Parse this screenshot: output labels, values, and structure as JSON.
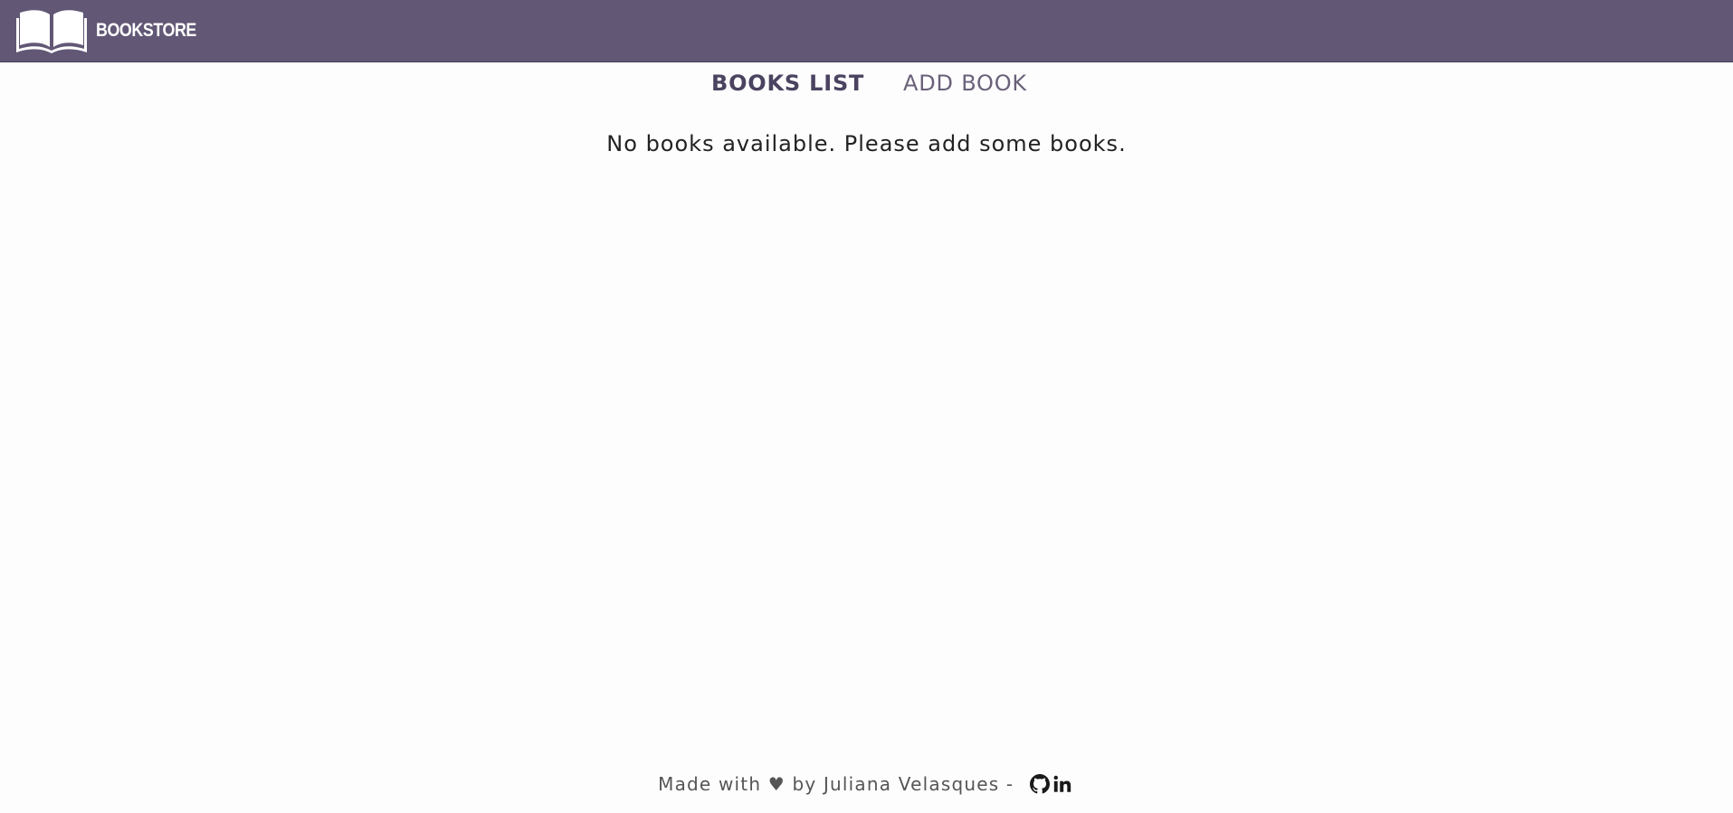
{
  "header": {
    "brand": "BOOKSTORE",
    "background_color": "#625775",
    "logo_icon": "open-book-icon"
  },
  "nav": {
    "items": [
      {
        "label": "BOOKS LIST",
        "active": true
      },
      {
        "label": "ADD BOOK",
        "active": false
      }
    ]
  },
  "main": {
    "empty_message": "No books available. Please add some books."
  },
  "footer": {
    "text": "Made with ♥ by Juliana Velasques - ",
    "icons": [
      "github-icon",
      "linkedin-icon"
    ]
  }
}
